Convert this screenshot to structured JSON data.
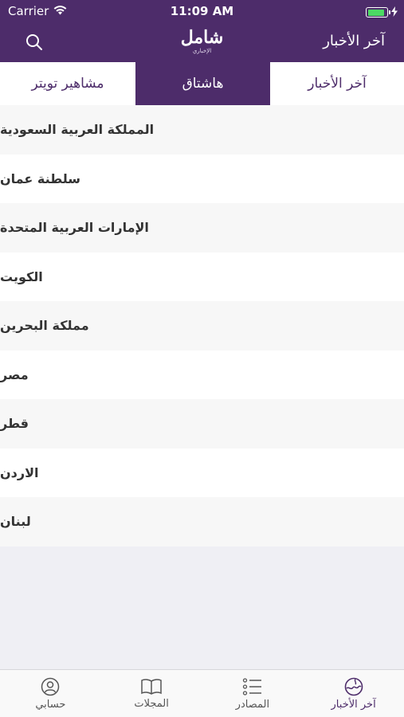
{
  "status_bar": {
    "carrier": "Carrier",
    "time": "11:09 AM",
    "battery_level": 0.9
  },
  "navbar": {
    "title": "آخر الأخبار",
    "logo_main": "شامل",
    "logo_sub": "الإخباري",
    "search_icon": "search-icon"
  },
  "tabs": [
    {
      "label": "مشاهير تويتر",
      "active": false
    },
    {
      "label": "هاشتاق",
      "active": true
    },
    {
      "label": "آخر الأخبار",
      "active": false
    }
  ],
  "countries": [
    "المملكة العربية السعودية",
    "سلطنة عمان",
    "الإمارات العربية المتحدة",
    "الكويت",
    "مملكة البحرين",
    "مصر",
    "قطر",
    "الاردن",
    "لبنان"
  ],
  "tabbar": [
    {
      "label": "حسابي",
      "icon": "person-icon",
      "active": false
    },
    {
      "label": "المجلات",
      "icon": "book-icon",
      "active": false
    },
    {
      "label": "المصادر",
      "icon": "list-icon",
      "active": false
    },
    {
      "label": "آخر الأخبار",
      "icon": "globe-icon",
      "active": true
    }
  ],
  "colors": {
    "primary": "#4d2c6a",
    "background": "#efeff4",
    "battery": "#4cd964"
  }
}
